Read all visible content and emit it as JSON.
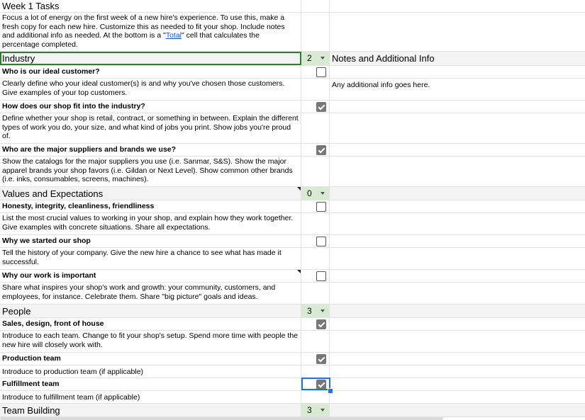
{
  "header": {
    "title": "Week 1 Tasks",
    "intro_before": "Focus a lot of energy on the first week of a new hire's experience. To use this, make a fresh copy for each new hire. Customize this as needed to fit your shop. Include notes and additional info as needed. At the bottom is a \"",
    "intro_link": "Total",
    "intro_after": "\" cell that calculates the percentage completed."
  },
  "sections": {
    "industry": {
      "label": "Industry",
      "count": "2",
      "notes_header": "Notes and Additional Info",
      "tasks": [
        {
          "title": "Who is our ideal customer?",
          "checked": false,
          "desc": "Clearly define who your ideal customer(s) is and why you've chosen those customers. Give examples of your top customers.",
          "note": "Any additional info goes here."
        },
        {
          "title": "How does our shop fit into the industry?",
          "checked": true,
          "desc": "Define whether your shop is retail, contract, or something in between. Explain the different types of work you do, your size, and what kind of jobs you print. Show jobs you're proud of."
        },
        {
          "title": "Who are the major suppliers and brands we use?",
          "checked": true,
          "desc": "Show the catalogs for the major suppliers you use (i.e. Sanmar, S&S). Show the major apparel brands your shop favors (i.e. Gildan or Next Level). Show common other brands (i.e. inks, consumables, screens, machines)."
        }
      ]
    },
    "values": {
      "label": "Values and Expectations",
      "count": "0",
      "tasks": [
        {
          "title": "Honesty, integrity, cleanliness, friendliness",
          "checked": false,
          "desc": "List the most crucial values to working in your shop, and explain how they work together. Give examples with concrete situations. Share all expectations."
        },
        {
          "title": "Why we started our shop",
          "checked": false,
          "desc": "Tell the history of your company. Give the new hire a chance to see what has made it successful."
        },
        {
          "title": "Why our work is important",
          "checked": false,
          "desc": "Share what inspires your shop's work and growth: your community, customers, and employees, for instance. Celebrate them. Share \"big picture\" goals and ideas."
        }
      ]
    },
    "people": {
      "label": "People",
      "count": "3",
      "tasks": [
        {
          "title": "Sales, design, front of house",
          "checked": true,
          "desc": "Introduce to each team. Change to fit your shop's setup. Spend more time with people the new hire will closely work with."
        },
        {
          "title": "Production team",
          "checked": true,
          "desc": "Introduce to production team (if applicable)"
        },
        {
          "title": "Fulfillment team",
          "checked": true,
          "desc": "Introduce to fulfillment team (if applicable)"
        }
      ]
    },
    "team_building": {
      "label": "Team Building",
      "count": "3"
    }
  }
}
